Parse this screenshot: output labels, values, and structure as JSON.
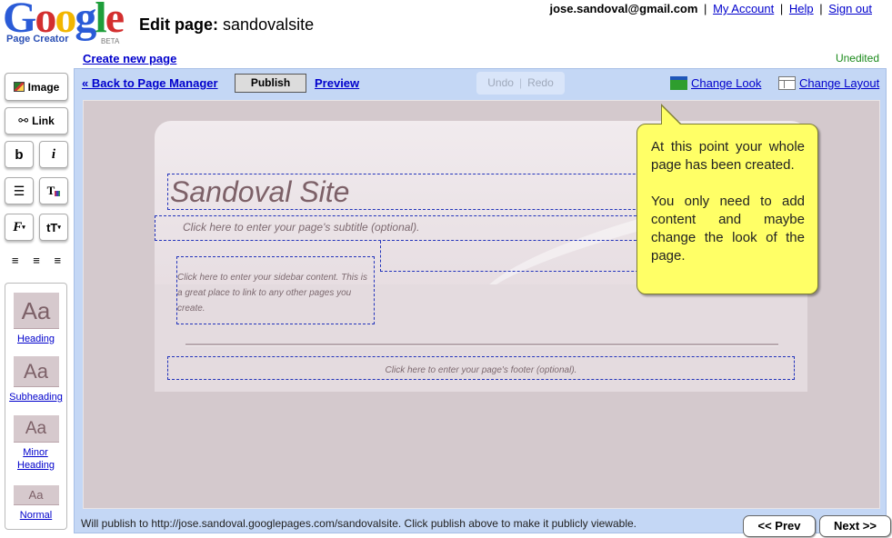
{
  "logo": {
    "word": "Google",
    "sub": "Page Creator",
    "beta": "BETA",
    "letter_colors": [
      "#2a5bd7",
      "#d32f2f",
      "#f2b600",
      "#2a5bd7",
      "#1e9e3a",
      "#d32f2f"
    ]
  },
  "header": {
    "title_prefix": "Edit page:",
    "site_name": "sandovalsite",
    "email": "jose.sandoval@gmail.com",
    "links": {
      "my_account": "My Account",
      "help": "Help",
      "sign_out": "Sign out"
    },
    "separator": "|",
    "create_new_page": "Create new page",
    "status": "Unedited"
  },
  "toolbar": {
    "back": "« Back to Page Manager",
    "publish": "Publish",
    "preview": "Preview",
    "undo": "Undo",
    "redo": "Redo",
    "change_look": "Change Look",
    "change_layout": "Change Layout"
  },
  "tools": {
    "image": "Image",
    "link": "Link",
    "bold": "b",
    "italic": "i",
    "font": "F",
    "size": "tT"
  },
  "styles": [
    {
      "sample": "Aa",
      "label": "Heading"
    },
    {
      "sample": "Aa",
      "label": "Subheading"
    },
    {
      "sample": "Aa",
      "label": "Minor Heading"
    },
    {
      "sample": "Aa",
      "label": "Normal"
    }
  ],
  "page": {
    "site_title": "Sandoval Site",
    "subtitle_placeholder": "Click here to enter your page's subtitle (optional).",
    "sidebar_placeholder": "Click here to enter your sidebar content. This is a great place to link to any other pages you create.",
    "footer_placeholder": "Click here to enter your page's footer (optional)."
  },
  "callout": {
    "p1": "At this point your whole page has been created.",
    "p2": "You only need to add content and maybe change the look of the page."
  },
  "status_bar": "Will publish to http://jose.sandoval.googlepages.com/sandovalsite. Click publish above to make it publicly viewable.",
  "nav": {
    "prev": "<<  Prev",
    "next": "Next  >>"
  }
}
